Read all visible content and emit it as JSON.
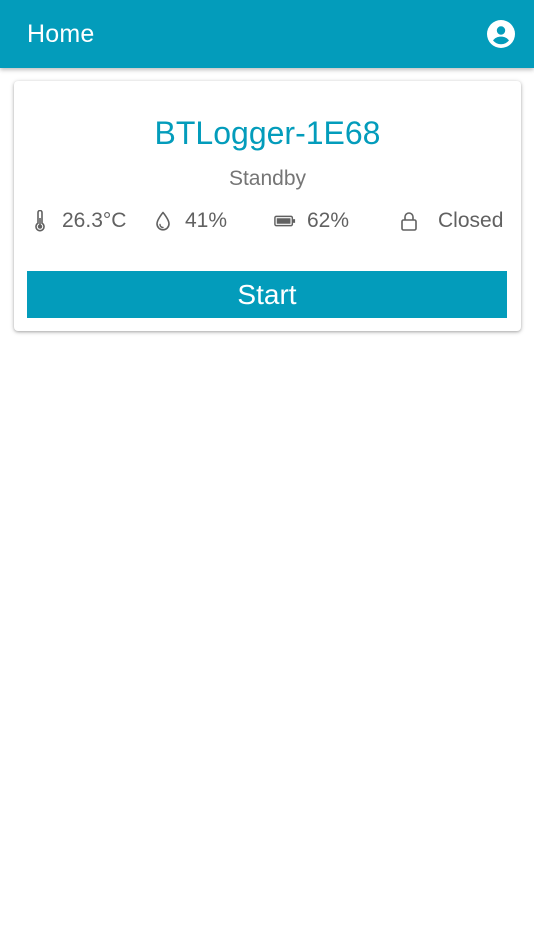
{
  "appbar": {
    "title": "Home",
    "account_icon": "account-circle-icon",
    "background": "#039cbb"
  },
  "device_card": {
    "name": "BTLogger-1E68",
    "status": "Standby",
    "readings": {
      "temperature": {
        "icon": "thermometer-icon",
        "value": "26.3°C"
      },
      "humidity": {
        "icon": "water-drop-icon",
        "value": "41%"
      },
      "battery": {
        "icon": "battery-icon",
        "value": "62%"
      },
      "lock": {
        "icon": "lock-icon",
        "value": "Closed"
      }
    },
    "start_label": "Start"
  },
  "colors": {
    "accent": "#039cbb",
    "secondary_text": "#757575",
    "body_text": "#616161"
  }
}
